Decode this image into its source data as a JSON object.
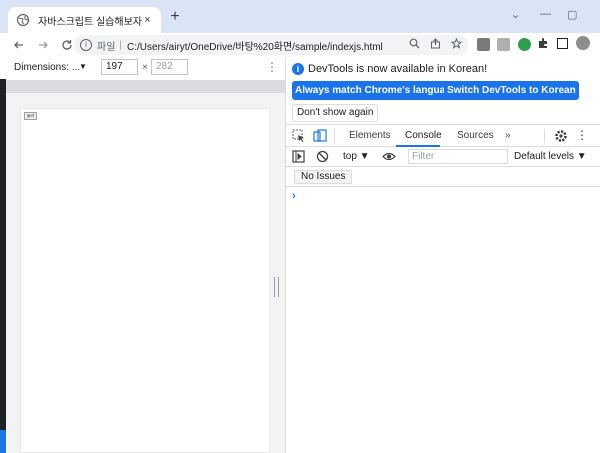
{
  "browser": {
    "tab_title": "자바스크립트 실습해보자",
    "tab_close": "×",
    "new_tab": "+",
    "window_controls": [
      "⌄",
      "—",
      "▢"
    ],
    "omnibox": {
      "scheme_label": "파일",
      "separator": "|",
      "url": "C:/Users/airyt/OneDrive/바탕%20화면/sample/indexjs.html"
    }
  },
  "device_toolbar": {
    "dimensions_label": "Dimensions: ...",
    "caret": "▼",
    "width": "197",
    "times": "×",
    "height": "282",
    "more": "⋮"
  },
  "page": {
    "button_label": "눌러"
  },
  "devtools": {
    "infobar": {
      "message": "DevTools is now available in Korean!",
      "match_language_button": "Always match Chrome's language",
      "switch_language_button": "Switch DevTools to Korean",
      "dont_show_button": "Don't show again"
    },
    "tabs": [
      "Elements",
      "Console",
      "Sources"
    ],
    "more_tabs": "»",
    "console": {
      "context": "top",
      "filter_placeholder": "Filter",
      "levels": "Default levels",
      "issues": "No Issues",
      "prompt": "›"
    }
  },
  "colors": {
    "accent": "#1a73e8",
    "tabstrip": "#d9e4f7",
    "panel_border": "#dadce0"
  }
}
